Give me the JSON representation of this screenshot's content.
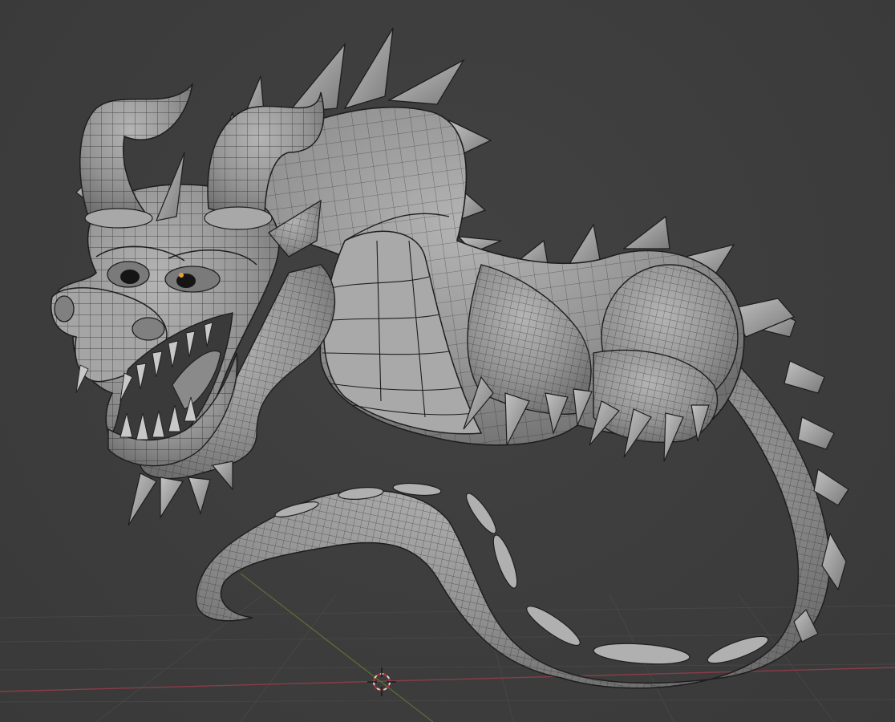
{
  "viewport": {
    "name": "3D Viewport",
    "shading": "solid",
    "overlay": "wireframe",
    "background_color": "#3c3c3c",
    "grid_color": "#4a4a4a",
    "x_axis_color": "#8a3c48",
    "y_axis_color": "#6b7a3a",
    "mesh_color": "#9a9a9a",
    "wire_color": "#1e1e1e"
  },
  "scene": {
    "object": "dragon-sculpt-mesh",
    "cursor_icon": "3d-cursor-icon"
  }
}
